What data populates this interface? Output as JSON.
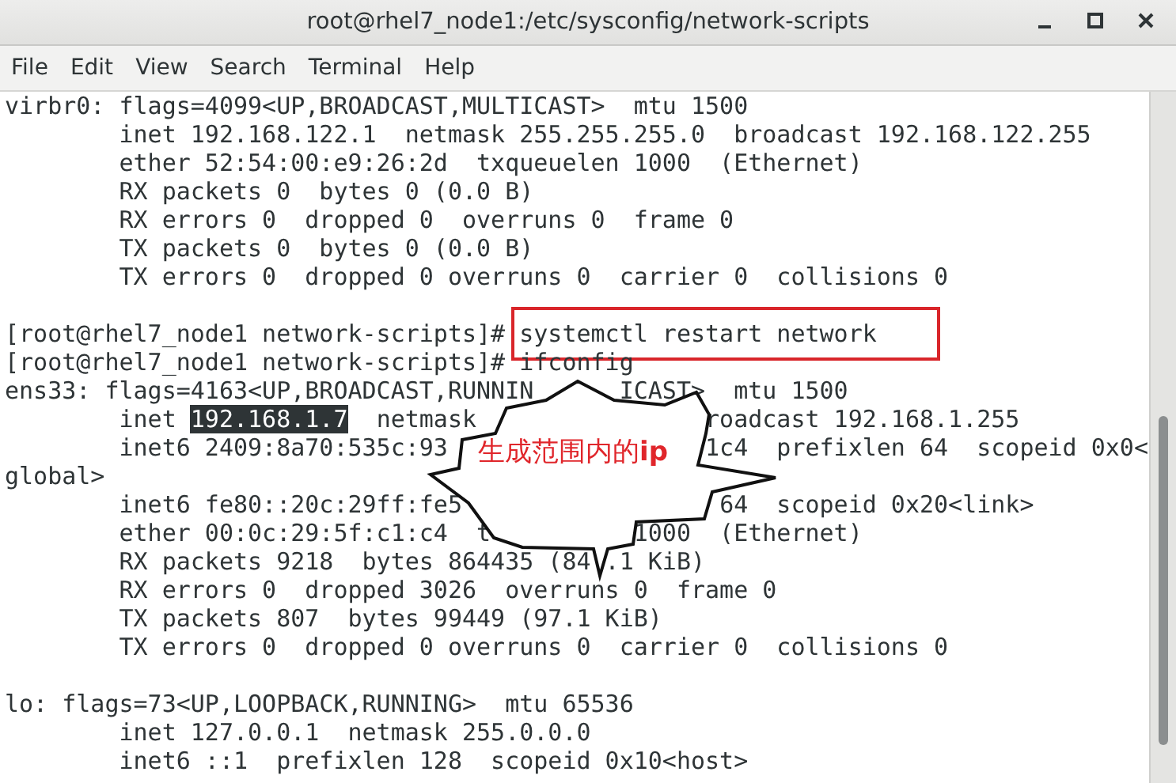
{
  "window": {
    "title": "root@rhel7_node1:/etc/sysconfig/network-scripts"
  },
  "menu": [
    {
      "label": "File"
    },
    {
      "label": "Edit"
    },
    {
      "label": "View"
    },
    {
      "label": "Search"
    },
    {
      "label": "Terminal"
    },
    {
      "label": "Help"
    }
  ],
  "lines": [
    {
      "kind": "text",
      "segments": [
        {
          "text": "virbr0: flags=4099<UP,BROADCAST,MULTICAST>  mtu 1500"
        }
      ]
    },
    {
      "kind": "text",
      "segments": [
        {
          "text": "        inet 192.168.122.1  netmask 255.255.255.0  broadcast 192.168.122.255"
        }
      ]
    },
    {
      "kind": "text",
      "segments": [
        {
          "text": "        ether 52:54:00:e9:26:2d  txqueuelen 1000  (Ethernet)"
        }
      ]
    },
    {
      "kind": "text",
      "segments": [
        {
          "text": "        RX packets 0  bytes 0 (0.0 B)"
        }
      ]
    },
    {
      "kind": "text",
      "segments": [
        {
          "text": "        RX errors 0  dropped 0  overruns 0  frame 0"
        }
      ]
    },
    {
      "kind": "text",
      "segments": [
        {
          "text": "        TX packets 0  bytes 0 (0.0 B)"
        }
      ]
    },
    {
      "kind": "text",
      "segments": [
        {
          "text": "        TX errors 0  dropped 0 overruns 0  carrier 0  collisions 0"
        }
      ]
    },
    {
      "kind": "blank"
    },
    {
      "kind": "text",
      "segments": [
        {
          "text": "[root@rhel7_node1 network-scripts]#"
        },
        {
          "text": " systemctl restart network",
          "boxed": true
        }
      ]
    },
    {
      "kind": "text",
      "segments": [
        {
          "text": "[root@rhel7_node1 network-scripts]# ifconfig"
        }
      ]
    },
    {
      "kind": "text",
      "segments": [
        {
          "text": "ens33: flags=4163<UP,BROADCAST,RUNNIN"
        },
        {
          "text": "      ICAST>  mtu 1500"
        }
      ]
    },
    {
      "kind": "text",
      "segments": [
        {
          "text": "        inet"
        },
        {
          "text": " 192.168.1.7",
          "highlighted": true
        },
        {
          "text": "  netmask"
        },
        {
          "text": "                roadcast 192.168.1.255"
        }
      ]
    },
    {
      "kind": "text",
      "segments": [
        {
          "text": "        inet6 2409:8a70:535c:93"
        },
        {
          "text": "                  1c4  prefixlen 64  scopeid 0x0<"
        }
      ]
    },
    {
      "kind": "text",
      "segments": [
        {
          "text": "global>"
        }
      ]
    },
    {
      "kind": "text",
      "segments": [
        {
          "text": "        inet6 fe80::20c:29ff:fe5"
        },
        {
          "text": "                  64  scopeid 0x20<link>"
        }
      ]
    },
    {
      "kind": "text",
      "segments": [
        {
          "text": "        ether 00:0c:29:5f:c1:c4  t"
        },
        {
          "text": "          1000  (Ethernet)"
        }
      ]
    },
    {
      "kind": "text",
      "segments": [
        {
          "text": "        RX packets 9218  bytes 864435 (84"
        },
        {
          "text": " .1 KiB)"
        }
      ]
    },
    {
      "kind": "text",
      "segments": [
        {
          "text": "        RX errors 0  dropped 3026  overruns 0  frame 0"
        }
      ]
    },
    {
      "kind": "text",
      "segments": [
        {
          "text": "        TX packets 807  bytes 99449 (97.1 KiB)"
        }
      ]
    },
    {
      "kind": "text",
      "segments": [
        {
          "text": "        TX errors 0  dropped 0 overruns 0  carrier 0  collisions 0"
        }
      ]
    },
    {
      "kind": "blank"
    },
    {
      "kind": "text",
      "segments": [
        {
          "text": "lo: flags=73<UP,LOOPBACK,RUNNING>  mtu 65536"
        }
      ]
    },
    {
      "kind": "text",
      "segments": [
        {
          "text": "        inet 127.0.0.1  netmask 255.0.0.0"
        }
      ]
    },
    {
      "kind": "text",
      "segments": [
        {
          "text": "        inet6 ::1  prefixlen 128  scopeid 0x10<host>"
        }
      ]
    }
  ],
  "callout": {
    "text": "生成范围内的**ip**"
  }
}
